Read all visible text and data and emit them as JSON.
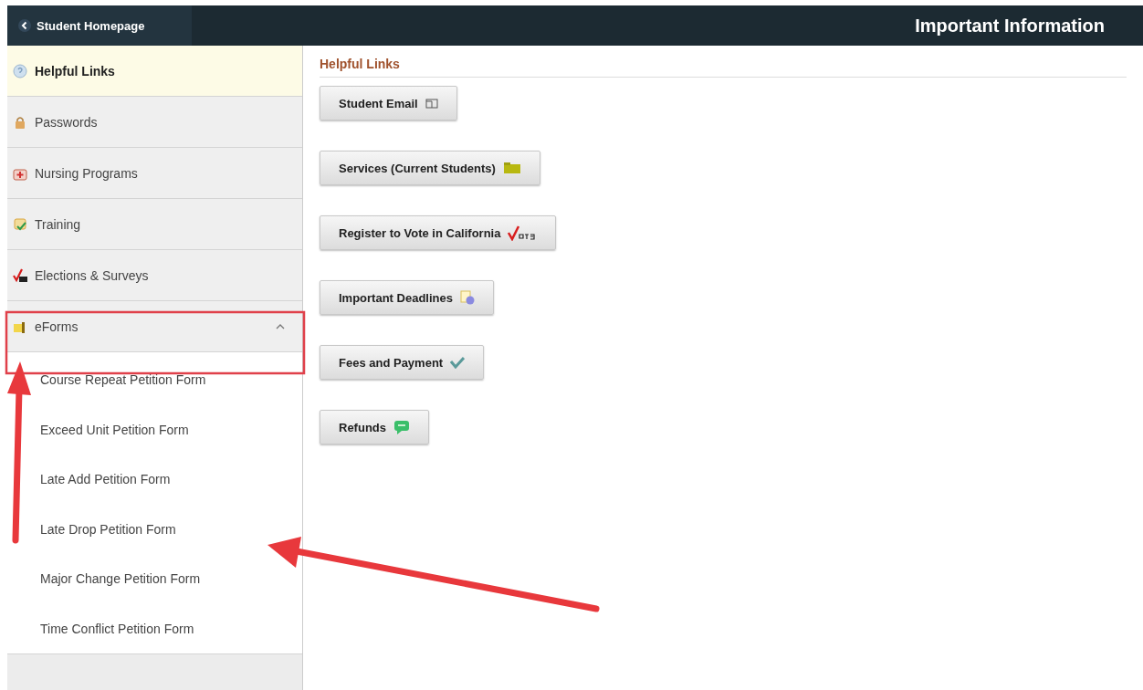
{
  "header": {
    "back_button": {
      "label": "Student Homepage"
    },
    "title": "Important Information"
  },
  "sidebar": {
    "items": [
      {
        "label": "Helpful Links",
        "selected": true
      },
      {
        "label": "Passwords",
        "selected": false
      },
      {
        "label": "Nursing Programs",
        "selected": false
      },
      {
        "label": "Training",
        "selected": false
      },
      {
        "label": "Elections & Surveys",
        "selected": false
      },
      {
        "label": "eForms",
        "selected": false,
        "expanded": true,
        "children": [
          {
            "label": "Course Repeat Petition Form"
          },
          {
            "label": "Exceed Unit Petition Form"
          },
          {
            "label": "Late Add Petition Form"
          },
          {
            "label": "Late Drop Petition Form"
          },
          {
            "label": "Major Change Petition Form"
          },
          {
            "label": "Time Conflict Petition Form"
          }
        ]
      }
    ]
  },
  "content": {
    "section_title": "Helpful Links",
    "buttons": [
      {
        "label": "Student Email"
      },
      {
        "label": "Services (Current Students)"
      },
      {
        "label": "Register to Vote in California"
      },
      {
        "label": "Important Deadlines"
      },
      {
        "label": "Fees and Payment"
      },
      {
        "label": "Refunds"
      }
    ]
  },
  "annotations": [
    {
      "kind": "highlight-box"
    },
    {
      "kind": "arrow"
    },
    {
      "kind": "arrow"
    }
  ]
}
